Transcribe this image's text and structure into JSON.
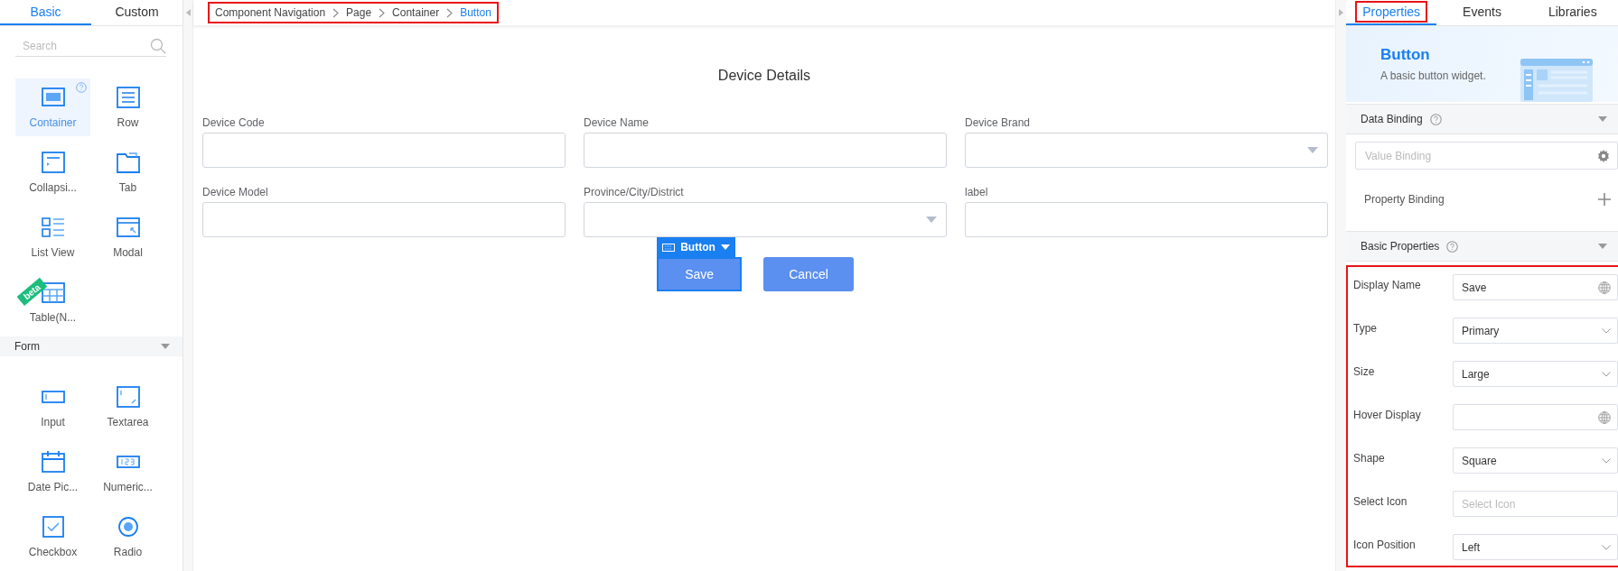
{
  "left_panel": {
    "tabs": [
      {
        "label": "Basic",
        "selected": true
      },
      {
        "label": "Custom",
        "selected": false
      }
    ],
    "search": {
      "placeholder": "Search"
    },
    "components": [
      {
        "kind": "container",
        "label": "Container",
        "selected": true,
        "help": true
      },
      {
        "kind": "row",
        "label": "Row",
        "selected": false,
        "help": false
      },
      {
        "kind": "collapse",
        "label": "Collapsi...",
        "selected": false,
        "help": false
      },
      {
        "kind": "tab",
        "label": "Tab",
        "selected": false,
        "help": false
      },
      {
        "kind": "list",
        "label": "List View",
        "selected": false,
        "help": false
      },
      {
        "kind": "modal",
        "label": "Modal",
        "selected": false,
        "help": false
      },
      {
        "kind": "table",
        "label": "Table(N...",
        "selected": false,
        "help": false,
        "badge": "beta"
      }
    ],
    "form_group": {
      "title": "Form",
      "expanded": true,
      "items": [
        {
          "kind": "input",
          "label": "Input"
        },
        {
          "kind": "textarea",
          "label": "Textarea"
        },
        {
          "kind": "date",
          "label": "Date Pic..."
        },
        {
          "kind": "numeric",
          "label": "Numeric..."
        },
        {
          "kind": "checkbox",
          "label": "Checkbox"
        },
        {
          "kind": "radio",
          "label": "Radio"
        }
      ]
    }
  },
  "breadcrumb": {
    "highlighted": true,
    "items": [
      {
        "label": "Component Navigation",
        "selected": false
      },
      {
        "label": "Page",
        "selected": false
      },
      {
        "label": "Container",
        "selected": false
      },
      {
        "label": "Button",
        "selected": true
      }
    ]
  },
  "canvas": {
    "title": "Device Details",
    "fields": [
      {
        "label": "Device Code",
        "kind": "input"
      },
      {
        "label": "Device Name",
        "kind": "input"
      },
      {
        "label": "Device Brand",
        "kind": "select"
      },
      {
        "label": "Device Model",
        "kind": "input"
      },
      {
        "label": "Province/City/District",
        "kind": "select"
      },
      {
        "label": "label",
        "kind": "input"
      }
    ],
    "selection_toolbar": {
      "label": "Button"
    },
    "buttons": [
      {
        "label": "Save",
        "selected": true
      },
      {
        "label": "Cancel",
        "selected": false
      }
    ]
  },
  "right_panel": {
    "tabs": [
      {
        "label": "Properties",
        "selected": true,
        "highlighted": true
      },
      {
        "label": "Events",
        "selected": false,
        "highlighted": false
      },
      {
        "label": "Libraries",
        "selected": false,
        "highlighted": false
      }
    ],
    "header": {
      "title": "Button",
      "description": "A basic button widget."
    },
    "data_binding": {
      "title": "Data Binding",
      "expanded": true,
      "value_binding": {
        "placeholder": "Value Binding"
      },
      "property_binding": "Property Binding"
    },
    "basic_properties": {
      "title": "Basic Properties",
      "expanded": true,
      "highlighted": true,
      "rows": [
        {
          "label": "Display Name",
          "kind": "translatable",
          "value": "Save"
        },
        {
          "label": "Type",
          "kind": "select",
          "value": "Primary"
        },
        {
          "label": "Size",
          "kind": "select",
          "value": "Large"
        },
        {
          "label": "Hover Display",
          "kind": "translatable"
        },
        {
          "label": "Shape",
          "kind": "select",
          "value": "Square"
        },
        {
          "label": "Select Icon",
          "kind": "picker",
          "placeholder": "Select Icon"
        },
        {
          "label": "Icon Position",
          "kind": "select",
          "value": "Left"
        }
      ]
    }
  }
}
